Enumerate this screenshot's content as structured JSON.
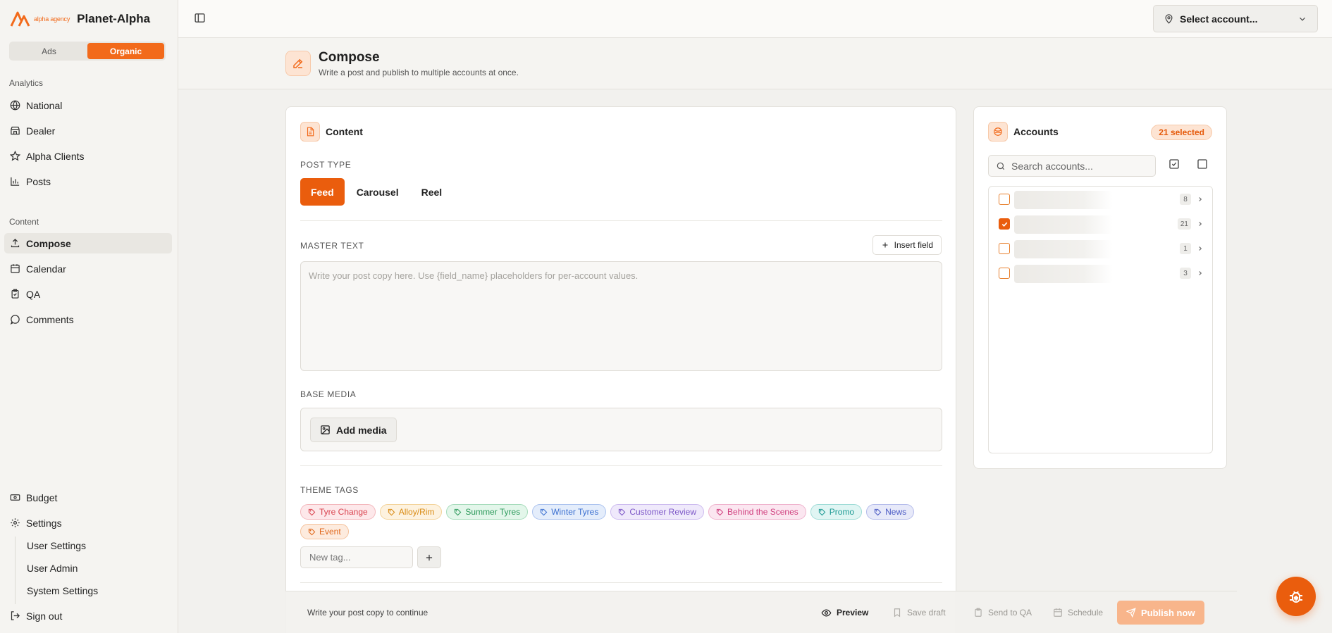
{
  "brand": {
    "logo_text": "alpha agency",
    "name": "Planet-Alpha"
  },
  "mode_toggle": {
    "ads": "Ads",
    "organic": "Organic"
  },
  "sidebar": {
    "analytics_label": "Analytics",
    "analytics_items": [
      {
        "label": "National",
        "icon": "globe-icon"
      },
      {
        "label": "Dealer",
        "icon": "store-icon"
      },
      {
        "label": "Alpha Clients",
        "icon": "star-icon"
      },
      {
        "label": "Posts",
        "icon": "bar-chart-icon"
      }
    ],
    "content_label": "Content",
    "content_items": [
      {
        "label": "Compose",
        "icon": "upload-icon",
        "active": true
      },
      {
        "label": "Calendar",
        "icon": "calendar-icon"
      },
      {
        "label": "QA",
        "icon": "clipboard-check-icon"
      },
      {
        "label": "Comments",
        "icon": "message-circle-icon"
      }
    ],
    "budget": "Budget",
    "settings": "Settings",
    "settings_sub": [
      "User Settings",
      "User Admin",
      "System Settings"
    ],
    "sign_out": "Sign out"
  },
  "topbar": {
    "account_select": "Select account..."
  },
  "page_header": {
    "title": "Compose",
    "subtitle": "Write a post and publish to multiple accounts at once."
  },
  "content_card": {
    "title": "Content",
    "post_type_label": "POST TYPE",
    "post_types": [
      "Feed",
      "Carousel",
      "Reel"
    ],
    "active_post_type": "Feed",
    "master_text_label": "MASTER TEXT",
    "insert_field": "Insert field",
    "master_text_placeholder": "Write your post copy here. Use {field_name} placeholders for per-account values.",
    "base_media_label": "BASE MEDIA",
    "add_media": "Add media",
    "theme_tags_label": "THEME TAGS",
    "tags": [
      {
        "label": "Tyre Change",
        "color": "#d9434f",
        "bg": "#fde8ea",
        "border": "#f3b8bd"
      },
      {
        "label": "Alloy/Rim",
        "color": "#d98a12",
        "bg": "#fdf2df",
        "border": "#f3d49c"
      },
      {
        "label": "Summer Tyres",
        "color": "#2e9a5c",
        "bg": "#e3f6ea",
        "border": "#a7dcbc"
      },
      {
        "label": "Winter Tyres",
        "color": "#3a6fd0",
        "bg": "#e4edfb",
        "border": "#adc4ef"
      },
      {
        "label": "Customer Review",
        "color": "#7c57c7",
        "bg": "#efe9fb",
        "border": "#cdbcef"
      },
      {
        "label": "Behind the Scenes",
        "color": "#d0407f",
        "bg": "#fbe6f0",
        "border": "#efb4ce"
      },
      {
        "label": "Promo",
        "color": "#1d9a94",
        "bg": "#e0f5f3",
        "border": "#a0dcd7"
      },
      {
        "label": "News",
        "color": "#4a59c4",
        "bg": "#e7e9f9",
        "border": "#b6bdeb"
      },
      {
        "label": "Event",
        "color": "#e0661a",
        "bg": "#fdebde",
        "border": "#f5c29c"
      }
    ],
    "new_tag_placeholder": "New tag..."
  },
  "accounts_card": {
    "title": "Accounts",
    "selected_badge": "21 selected",
    "search_placeholder": "Search accounts...",
    "groups": [
      {
        "count": "8",
        "checked": false
      },
      {
        "count": "21",
        "checked": true
      },
      {
        "count": "1",
        "checked": false
      },
      {
        "count": "3",
        "checked": false
      }
    ]
  },
  "action_bar": {
    "hint": "Write your post copy to continue",
    "preview": "Preview",
    "save_draft": "Save draft",
    "send_to_qa": "Send to QA",
    "schedule": "Schedule",
    "publish_now": "Publish now"
  },
  "colors": {
    "accent": "#ea5d0d",
    "accent_light": "#fde4d3"
  }
}
